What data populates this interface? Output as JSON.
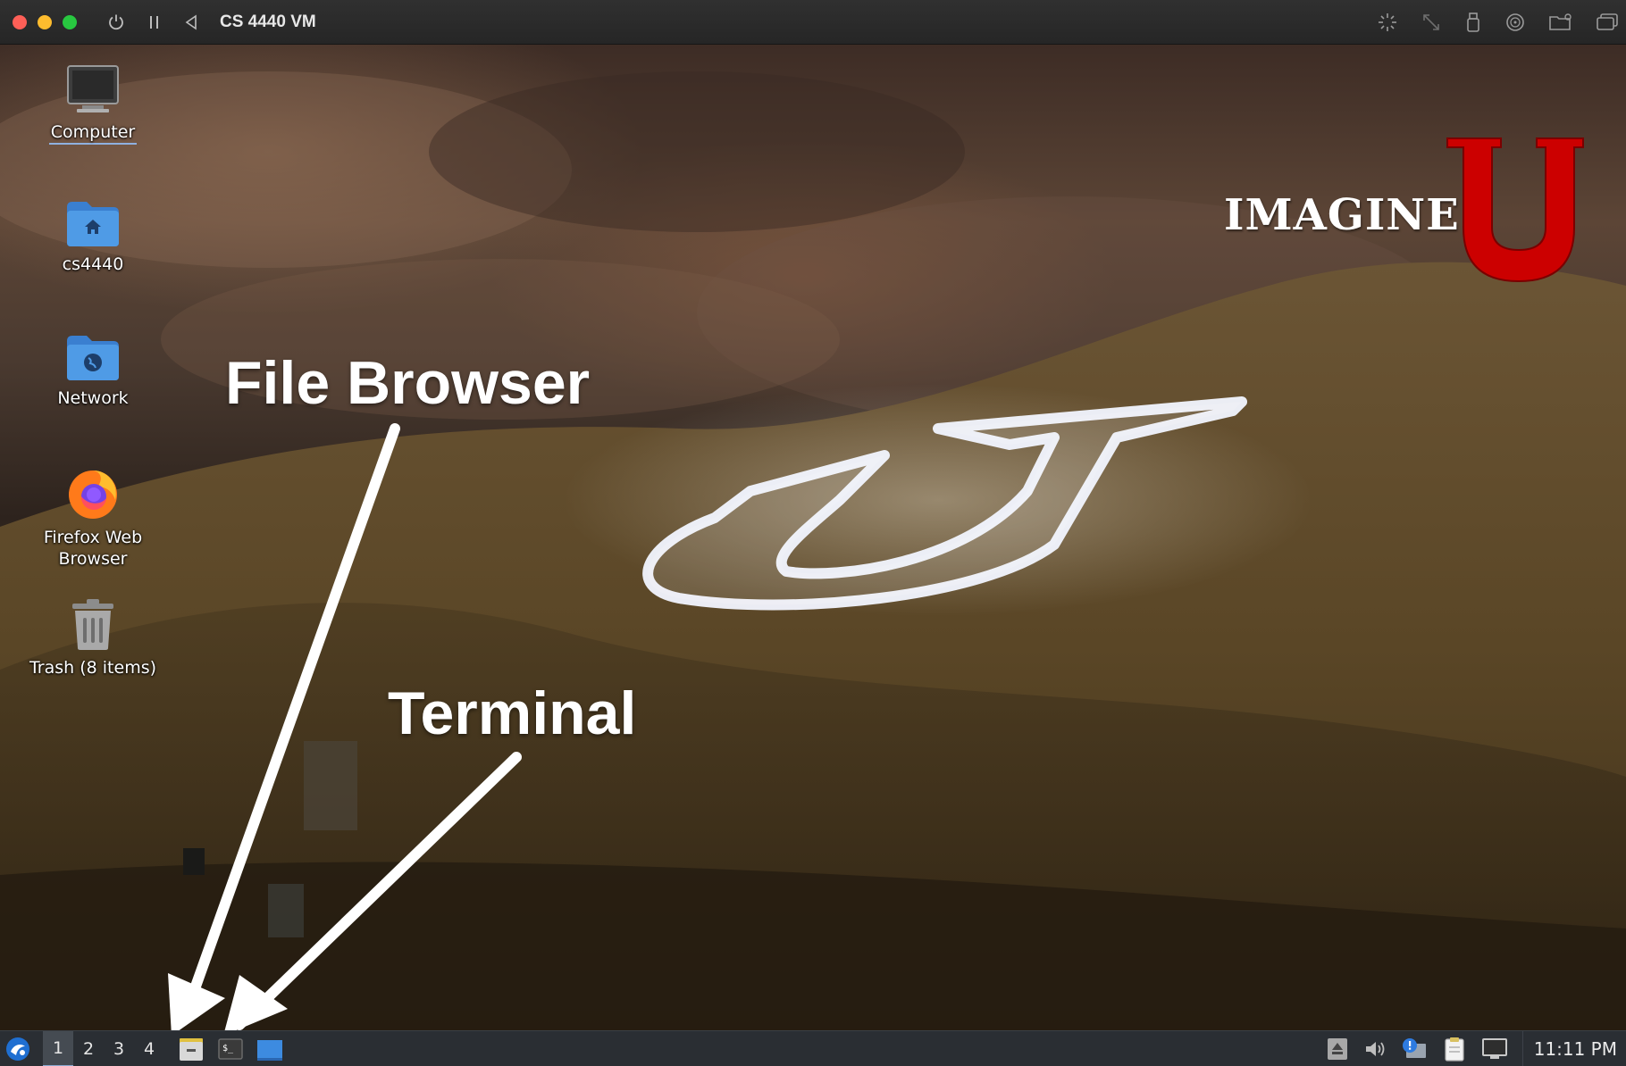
{
  "window": {
    "title": "CS 4440 VM"
  },
  "desktop": {
    "icons": [
      {
        "label": "Computer",
        "icon": "computer-icon"
      },
      {
        "label": "cs4440",
        "icon": "home-folder-icon"
      },
      {
        "label": "Network",
        "icon": "network-folder-icon"
      },
      {
        "label": "Firefox Web Browser",
        "icon": "firefox-icon"
      },
      {
        "label": "Trash (8 items)",
        "icon": "trash-icon"
      }
    ],
    "annotations": {
      "file_browser": "File Browser",
      "terminal": "Terminal"
    },
    "logo": {
      "text": "IMAGINE",
      "letter": "U",
      "color": "#cc0000"
    }
  },
  "taskbar": {
    "workspaces": [
      "1",
      "2",
      "3",
      "4"
    ],
    "active_workspace": "1",
    "launchers": [
      "file-manager-icon",
      "terminal-icon",
      "show-desktop-icon"
    ],
    "tray_icons": [
      "eject-icon",
      "volume-icon",
      "notification-icon",
      "clipboard-icon",
      "display-icon"
    ],
    "clock": "11:11 PM"
  }
}
